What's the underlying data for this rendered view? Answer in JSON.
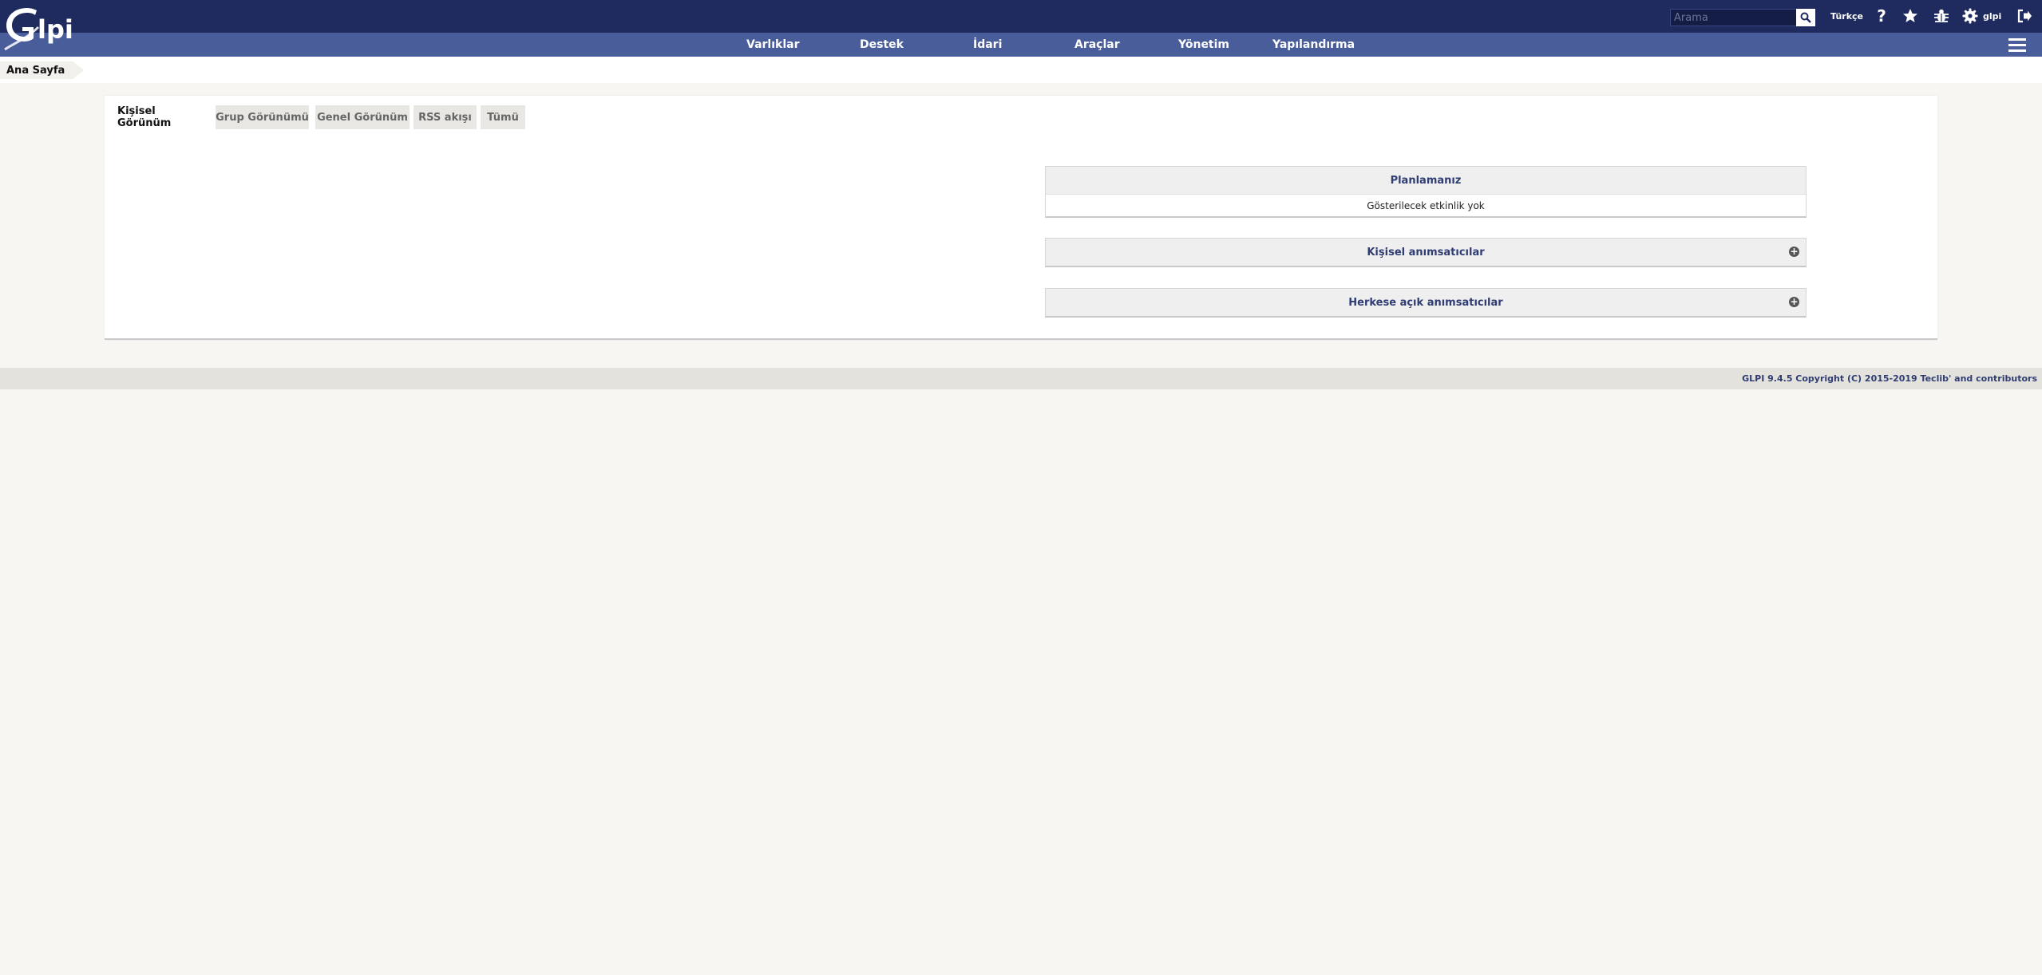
{
  "header": {
    "logo_text": "Glpi",
    "search_placeholder": "Arama",
    "language": "Türkçe",
    "user_name": "glpi"
  },
  "menu": {
    "items": [
      {
        "label": "Varlıklar"
      },
      {
        "label": "Destek"
      },
      {
        "label": "İdari"
      },
      {
        "label": "Araçlar"
      },
      {
        "label": "Yönetim"
      },
      {
        "label": "Yapılandırma"
      }
    ]
  },
  "breadcrumb": {
    "home": "Ana Sayfa"
  },
  "tabs": [
    {
      "label": "Kişisel Görünüm",
      "active": true
    },
    {
      "label": "Grup Görünümü",
      "active": false
    },
    {
      "label": "Genel Görünüm",
      "active": false
    },
    {
      "label": "RSS akışı",
      "active": false
    },
    {
      "label": "Tümü",
      "active": false
    }
  ],
  "panels": {
    "planning": {
      "title": "Planlamanız",
      "empty_message": "Gösterilecek etkinlik yok"
    },
    "personal_reminders": {
      "title": "Kişisel anımsatıcılar"
    },
    "public_reminders": {
      "title": "Herkese açık anımsatıcılar"
    }
  },
  "footer": {
    "copyright": "GLPI 9.4.5 Copyright (C) 2015-2019 Teclib' and contributors"
  },
  "colors": {
    "header_bg": "#1f2b5f",
    "menu_bg": "#4a5d9b",
    "accent_text": "#2f3d73",
    "page_bg": "#f7f6f2"
  }
}
